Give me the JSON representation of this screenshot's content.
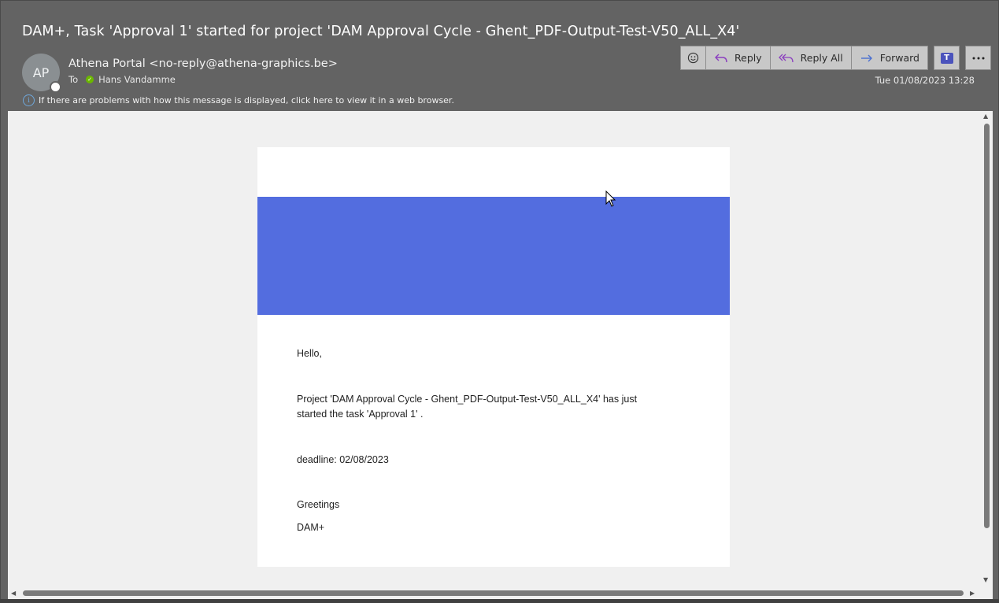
{
  "email": {
    "subject": "DAM+, Task 'Approval 1' started for project 'DAM Approval Cycle - Ghent_PDF-Output-Test-V50_ALL_X4'",
    "avatar_initials": "AP",
    "sender": "Athena Portal <no-reply@athena-graphics.be>",
    "to_label": "To",
    "recipient": "Hans Vandamme",
    "date": "Tue 01/08/2023 13:28",
    "info_text": "If there are problems with how this message is displayed, click here to view it in a web browser."
  },
  "toolbar": {
    "reply_label": "Reply",
    "reply_all_label": "Reply All",
    "forward_label": "Forward",
    "emoji_icon": "smiley-icon",
    "teams_icon": "teams-icon",
    "more_icon": "more-icon"
  },
  "message": {
    "greeting": "Hello,",
    "line1": "Project 'DAM Approval Cycle - Ghent_PDF-Output-Test-V50_ALL_X4' has just",
    "line2": "started the task 'Approval 1' .",
    "deadline": "deadline: 02/08/2023",
    "closing": "Greetings",
    "signature": "DAM+"
  },
  "colors": {
    "banner": "#536ddf",
    "window_bg": "#636363",
    "card_bg": "#ffffff",
    "reading_pane_bg": "#f0f0f0"
  }
}
